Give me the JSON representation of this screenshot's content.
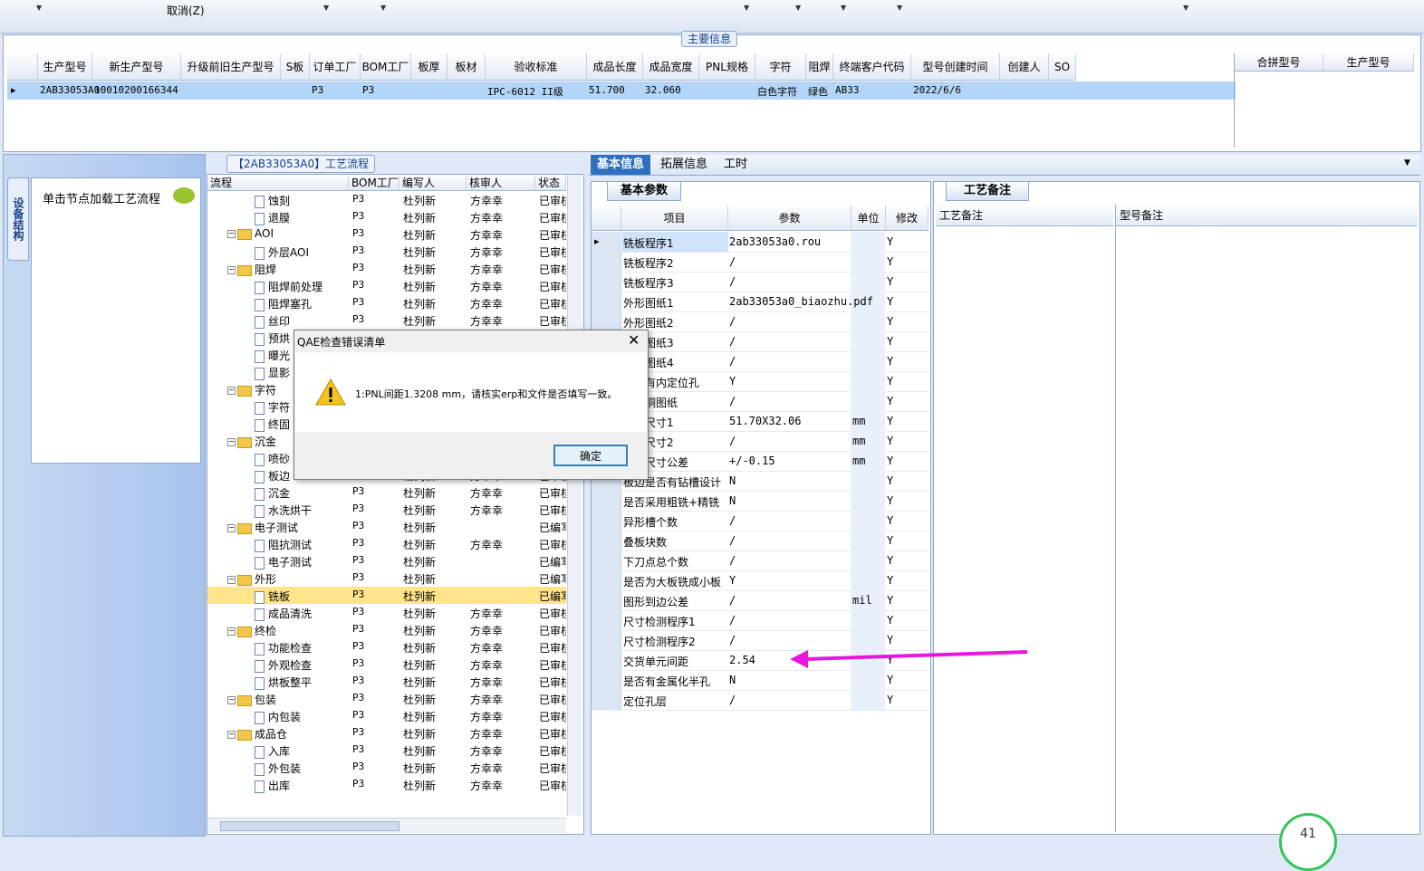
{
  "toolbar": {
    "cancel_label": "取消(Z)"
  },
  "main_info": {
    "title": "主要信息",
    "columns": [
      "生产型号",
      "新生产型号",
      "升级前旧生产型号",
      "S板",
      "订单工厂",
      "BOM工厂",
      "板厚",
      "板材",
      "验收标准",
      "成品长度",
      "成品宽度",
      "PNL规格",
      "字符",
      "阻焊",
      "终端客户代码",
      "型号创建时间",
      "创建人",
      "SO"
    ],
    "row": [
      "2AB33053A0",
      "10010200166344",
      "",
      "",
      "P3",
      "P3",
      "",
      "",
      "IPC-6012 II级",
      "51.700",
      "32.060",
      "",
      "白色字符",
      "绿色",
      "AB33",
      "2022/6/6",
      "",
      ""
    ],
    "side_columns": [
      "合拼型号",
      "生产型号"
    ]
  },
  "left": {
    "vtab_label": "设备结构",
    "load_label": "单击节点加载工艺流程"
  },
  "tree": {
    "title": "【2AB33053A0】工艺流程",
    "columns": [
      "流程",
      "BOM工厂",
      "编写人",
      "核审人",
      "状态"
    ],
    "rows": [
      {
        "name": "蚀刻",
        "level": 2,
        "folder": false,
        "bom": "P3",
        "writer": "杜列新",
        "reviewer": "方幸幸",
        "status": "已审核"
      },
      {
        "name": "退膜",
        "level": 2,
        "folder": false,
        "bom": "P3",
        "writer": "杜列新",
        "reviewer": "方幸幸",
        "status": "已审核"
      },
      {
        "name": "AOI",
        "level": 1,
        "folder": true,
        "bom": "P3",
        "writer": "杜列新",
        "reviewer": "方幸幸",
        "status": "已审核"
      },
      {
        "name": "外层AOI",
        "level": 2,
        "folder": false,
        "bom": "P3",
        "writer": "杜列新",
        "reviewer": "方幸幸",
        "status": "已审核"
      },
      {
        "name": "阻焊",
        "level": 1,
        "folder": true,
        "bom": "P3",
        "writer": "杜列新",
        "reviewer": "方幸幸",
        "status": "已审核"
      },
      {
        "name": "阻焊前处理",
        "level": 2,
        "folder": false,
        "bom": "P3",
        "writer": "杜列新",
        "reviewer": "方幸幸",
        "status": "已审核"
      },
      {
        "name": "阻焊塞孔",
        "level": 2,
        "folder": false,
        "bom": "P3",
        "writer": "杜列新",
        "reviewer": "方幸幸",
        "status": "已审核"
      },
      {
        "name": "丝印",
        "level": 2,
        "folder": false,
        "bom": "P3",
        "writer": "杜列新",
        "reviewer": "方幸幸",
        "status": "已审核"
      },
      {
        "name": "预烘",
        "level": 2,
        "folder": false,
        "bom": "P3",
        "writer": "杜列新",
        "reviewer": "方幸幸",
        "status": "已审核"
      },
      {
        "name": "曝光",
        "level": 2,
        "folder": false,
        "bom": "P3",
        "writer": "杜列新",
        "reviewer": "方幸幸",
        "status": "已审核"
      },
      {
        "name": "显影",
        "level": 2,
        "folder": false,
        "bom": "P3",
        "writer": "杜列新",
        "reviewer": "方幸幸",
        "status": "已审核"
      },
      {
        "name": "字符",
        "level": 1,
        "folder": true,
        "bom": "P3",
        "writer": "杜列新",
        "reviewer": "方幸幸",
        "status": "已审核"
      },
      {
        "name": "字符",
        "level": 2,
        "folder": false,
        "bom": "P3",
        "writer": "杜列新",
        "reviewer": "方幸幸",
        "status": "已审核"
      },
      {
        "name": "终固",
        "level": 2,
        "folder": false,
        "bom": "P3",
        "writer": "杜列新",
        "reviewer": "方幸幸",
        "status": "已审核"
      },
      {
        "name": "沉金",
        "level": 1,
        "folder": true,
        "bom": "P3",
        "writer": "杜列新",
        "reviewer": "方幸幸",
        "status": "已审核"
      },
      {
        "name": "喷砂",
        "level": 2,
        "folder": false,
        "bom": "P3",
        "writer": "杜列新",
        "reviewer": "方幸幸",
        "status": "已审核"
      },
      {
        "name": "板边",
        "level": 2,
        "folder": false,
        "bom": "P3",
        "writer": "杜列新",
        "reviewer": "方幸幸",
        "status": "已审核"
      },
      {
        "name": "沉金",
        "level": 2,
        "folder": false,
        "bom": "P3",
        "writer": "杜列新",
        "reviewer": "方幸幸",
        "status": "已审核"
      },
      {
        "name": "水洗烘干",
        "level": 2,
        "folder": false,
        "bom": "P3",
        "writer": "杜列新",
        "reviewer": "方幸幸",
        "status": "已审核"
      },
      {
        "name": "电子测试",
        "level": 1,
        "folder": true,
        "bom": "P3",
        "writer": "杜列新",
        "reviewer": "",
        "status": "已编写"
      },
      {
        "name": "阻抗测试",
        "level": 2,
        "folder": false,
        "bom": "P3",
        "writer": "杜列新",
        "reviewer": "方幸幸",
        "status": "已审核"
      },
      {
        "name": "电子测试",
        "level": 2,
        "folder": false,
        "bom": "P3",
        "writer": "杜列新",
        "reviewer": "",
        "status": "已编写"
      },
      {
        "name": "外形",
        "level": 1,
        "folder": true,
        "bom": "P3",
        "writer": "杜列新",
        "reviewer": "",
        "status": "已编写"
      },
      {
        "name": "铣板",
        "level": 2,
        "folder": false,
        "bom": "P3",
        "writer": "杜列新",
        "reviewer": "",
        "status": "已编写",
        "selected": true
      },
      {
        "name": "成品清洗",
        "level": 2,
        "folder": false,
        "bom": "P3",
        "writer": "杜列新",
        "reviewer": "方幸幸",
        "status": "已审核"
      },
      {
        "name": "终检",
        "level": 1,
        "folder": true,
        "bom": "P3",
        "writer": "杜列新",
        "reviewer": "方幸幸",
        "status": "已审核"
      },
      {
        "name": "功能检查",
        "level": 2,
        "folder": false,
        "bom": "P3",
        "writer": "杜列新",
        "reviewer": "方幸幸",
        "status": "已审核"
      },
      {
        "name": "外观检查",
        "level": 2,
        "folder": false,
        "bom": "P3",
        "writer": "杜列新",
        "reviewer": "方幸幸",
        "status": "已审核"
      },
      {
        "name": "烘板整平",
        "level": 2,
        "folder": false,
        "bom": "P3",
        "writer": "杜列新",
        "reviewer": "方幸幸",
        "status": "已审核"
      },
      {
        "name": "包装",
        "level": 1,
        "folder": true,
        "bom": "P3",
        "writer": "杜列新",
        "reviewer": "方幸幸",
        "status": "已审核"
      },
      {
        "name": "内包装",
        "level": 2,
        "folder": false,
        "bom": "P3",
        "writer": "杜列新",
        "reviewer": "方幸幸",
        "status": "已审核"
      },
      {
        "name": "成品仓",
        "level": 1,
        "folder": true,
        "bom": "P3",
        "writer": "杜列新",
        "reviewer": "方幸幸",
        "status": "已审核"
      },
      {
        "name": "入库",
        "level": 2,
        "folder": false,
        "bom": "P3",
        "writer": "杜列新",
        "reviewer": "方幸幸",
        "status": "已审核"
      },
      {
        "name": "外包装",
        "level": 2,
        "folder": false,
        "bom": "P3",
        "writer": "杜列新",
        "reviewer": "方幸幸",
        "status": "已审核"
      },
      {
        "name": "出库",
        "level": 2,
        "folder": false,
        "bom": "P3",
        "writer": "杜列新",
        "reviewer": "方幸幸",
        "status": "已审核"
      }
    ]
  },
  "tabs": [
    "基本信息",
    "拓展信息",
    "工时"
  ],
  "params": {
    "tab_label": "基本参数",
    "columns": [
      "项目",
      "参数",
      "单位",
      "修改"
    ],
    "rows": [
      {
        "item": "铣板程序1",
        "value": "2ab33053a0.rou",
        "unit": "",
        "mod": "Y"
      },
      {
        "item": "铣板程序2",
        "value": "/",
        "unit": "",
        "mod": "Y"
      },
      {
        "item": "铣板程序3",
        "value": "/",
        "unit": "",
        "mod": "Y"
      },
      {
        "item": "外形图纸1",
        "value": "2ab33053a0_biaozhu.pdf",
        "unit": "",
        "mod": "Y"
      },
      {
        "item": "外形图纸2",
        "value": "/",
        "unit": "",
        "mod": "Y"
      },
      {
        "item": "外形图纸3",
        "value": "/",
        "unit": "",
        "mod": "Y"
      },
      {
        "item": "外形图纸4",
        "value": "/",
        "unit": "",
        "mod": "Y"
      },
      {
        "item": "是否有内定位孔",
        "value": "Y",
        "unit": "",
        "mod": "Y"
      },
      {
        "item": "外露铜图纸",
        "value": "/",
        "unit": "",
        "mod": "Y"
      },
      {
        "item": "外形尺寸1",
        "value": "51.70X32.06",
        "unit": "mm",
        "mod": "Y"
      },
      {
        "item": "外形尺寸2",
        "value": "/",
        "unit": "mm",
        "mod": "Y"
      },
      {
        "item": "铣板尺寸公差",
        "value": "+/-0.15",
        "unit": "mm",
        "mod": "Y"
      },
      {
        "item": "板边是否有钻槽设计",
        "value": "N",
        "unit": "",
        "mod": "Y"
      },
      {
        "item": "是否采用粗铣+精铣",
        "value": "N",
        "unit": "",
        "mod": "Y"
      },
      {
        "item": "异形槽个数",
        "value": "/",
        "unit": "",
        "mod": "Y"
      },
      {
        "item": "叠板块数",
        "value": "/",
        "unit": "",
        "mod": "Y"
      },
      {
        "item": "下刀点总个数",
        "value": "/",
        "unit": "",
        "mod": "Y"
      },
      {
        "item": "是否为大板铣成小板",
        "value": "Y",
        "unit": "",
        "mod": "Y"
      },
      {
        "item": "图形到边公差",
        "value": "/",
        "unit": "mil",
        "mod": "Y"
      },
      {
        "item": "尺寸检测程序1",
        "value": "/",
        "unit": "",
        "mod": "Y"
      },
      {
        "item": "尺寸检测程序2",
        "value": "/",
        "unit": "",
        "mod": "Y"
      },
      {
        "item": "交货单元间距",
        "value": "2.54",
        "unit": "",
        "mod": "Y"
      },
      {
        "item": "是否有金属化半孔",
        "value": "N",
        "unit": "",
        "mod": "Y"
      },
      {
        "item": "定位孔层",
        "value": "/",
        "unit": "",
        "mod": "Y"
      }
    ]
  },
  "notes": {
    "tab_label": "工艺备注",
    "col1": "工艺备注",
    "col2": "型号备注"
  },
  "dialog": {
    "title": "QAE检查错误清单",
    "message": "1:PNL间距1.3208 mm，请核实erp和文件是否填写一致。",
    "ok_label": "确定"
  },
  "colors": {
    "accent": "#2f6fc0",
    "arrow": "#e817e0",
    "selected_row": "#ffe48a",
    "row_highlight": "#b3d5f7"
  },
  "badge": {
    "value": "41"
  }
}
